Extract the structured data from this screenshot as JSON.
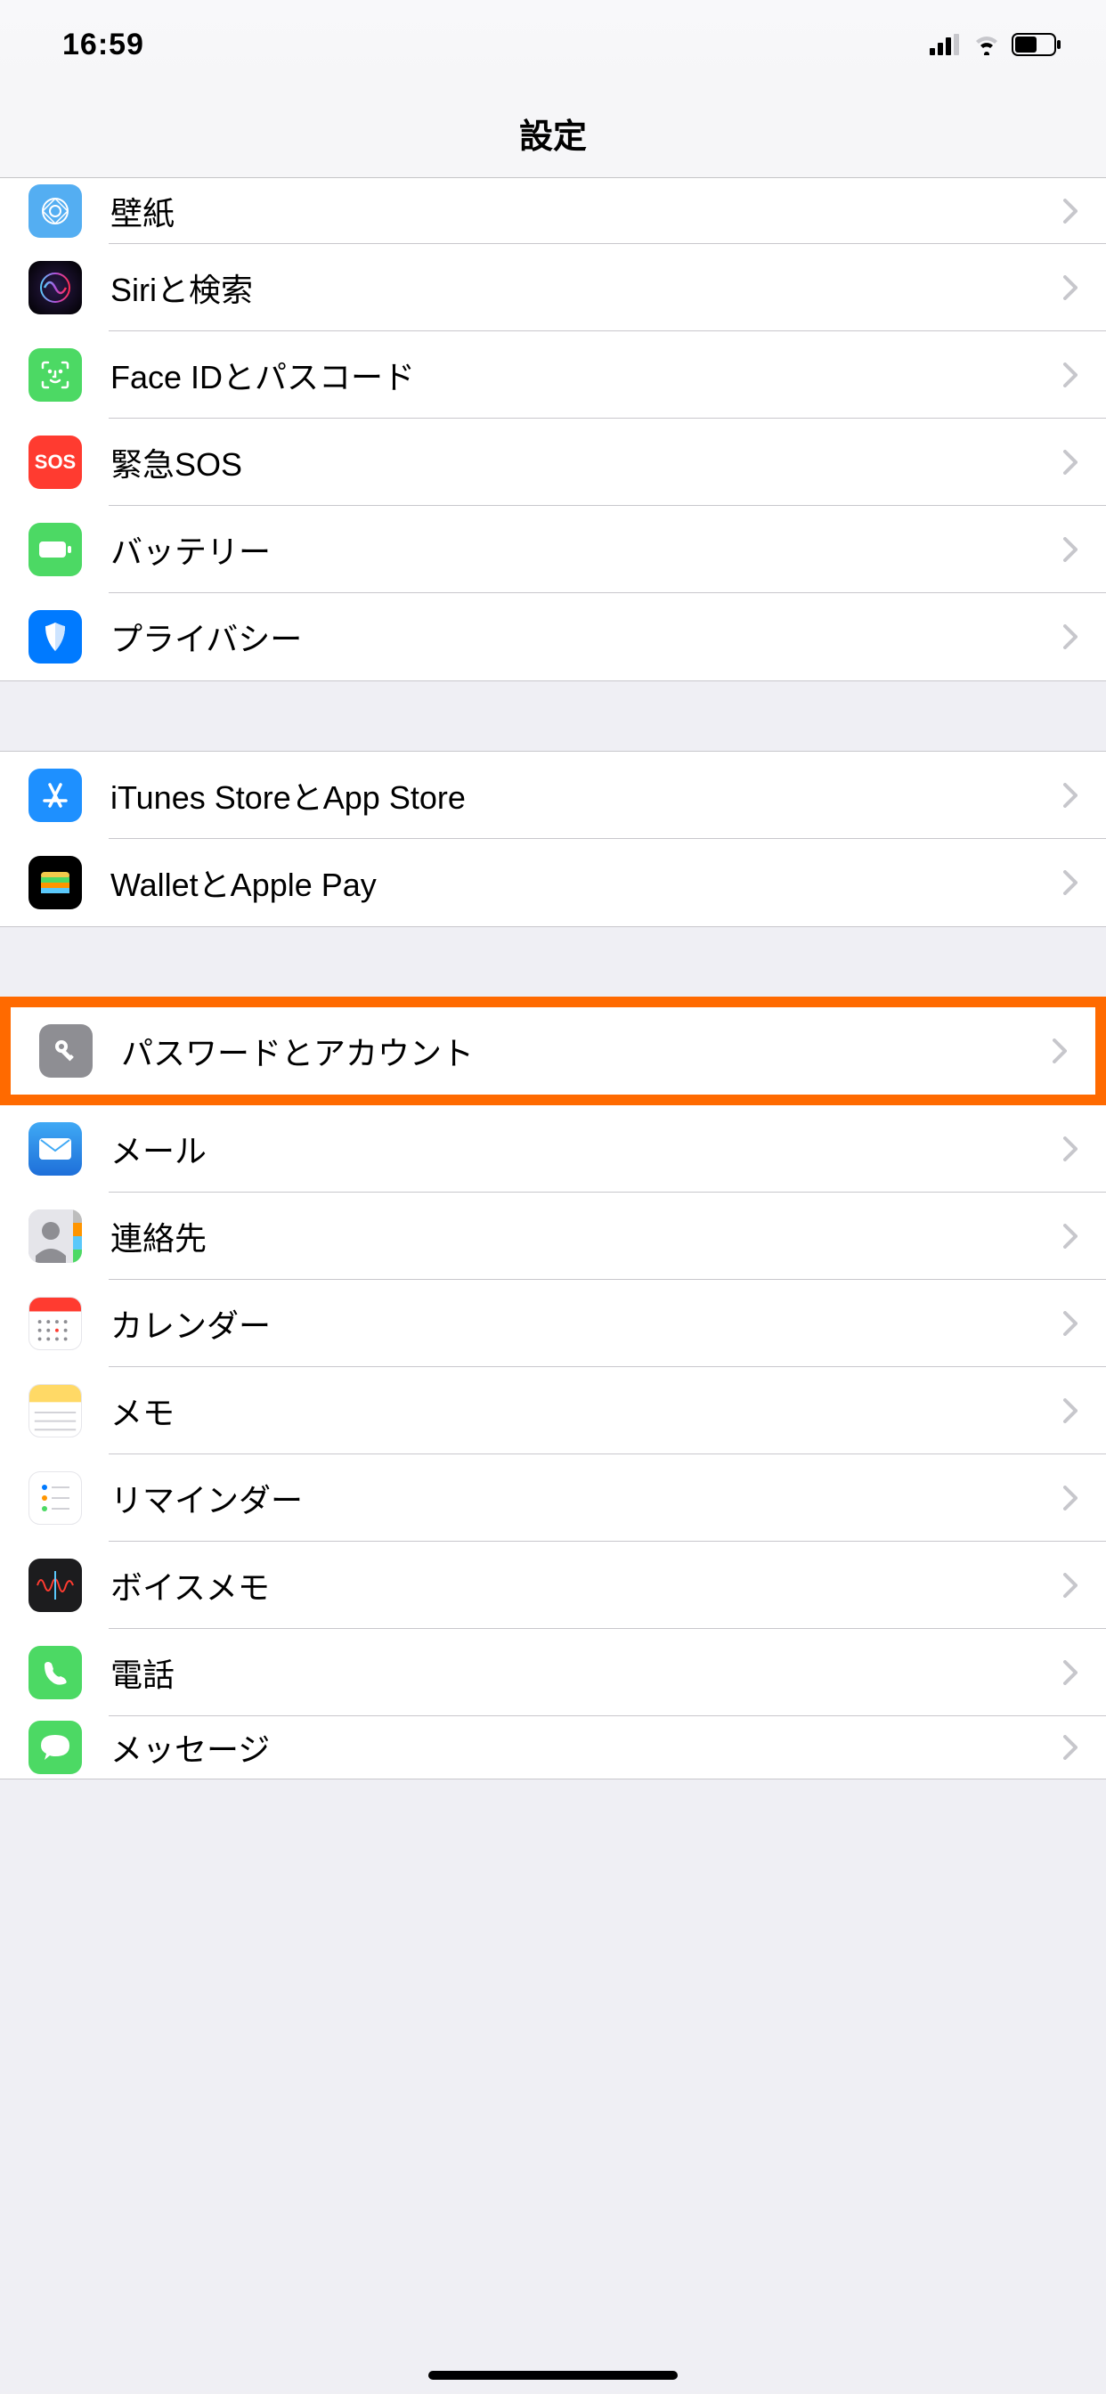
{
  "status": {
    "time": "16:59"
  },
  "header": {
    "title": "設定"
  },
  "groups": [
    {
      "rows": [
        {
          "id": "wallpaper",
          "label": "壁紙",
          "icon": "wallpaper-icon"
        },
        {
          "id": "siri",
          "label": "Siriと検索",
          "icon": "siri-icon"
        },
        {
          "id": "faceid",
          "label": "Face IDとパスコード",
          "icon": "faceid-icon"
        },
        {
          "id": "sos",
          "label": "緊急SOS",
          "icon": "sos-icon"
        },
        {
          "id": "battery",
          "label": "バッテリー",
          "icon": "battery-icon"
        },
        {
          "id": "privacy",
          "label": "プライバシー",
          "icon": "privacy-icon"
        }
      ]
    },
    {
      "rows": [
        {
          "id": "itunes",
          "label": "iTunes StoreとApp Store",
          "icon": "appstore-icon"
        },
        {
          "id": "wallet",
          "label": "WalletとApple Pay",
          "icon": "wallet-icon"
        }
      ]
    },
    {
      "rows": [
        {
          "id": "passwords",
          "label": "パスワードとアカウント",
          "icon": "key-icon",
          "highlighted": true
        },
        {
          "id": "mail",
          "label": "メール",
          "icon": "mail-icon"
        },
        {
          "id": "contacts",
          "label": "連絡先",
          "icon": "contacts-icon"
        },
        {
          "id": "calendar",
          "label": "カレンダー",
          "icon": "calendar-icon"
        },
        {
          "id": "notes",
          "label": "メモ",
          "icon": "notes-icon"
        },
        {
          "id": "reminders",
          "label": "リマインダー",
          "icon": "reminders-icon"
        },
        {
          "id": "voicememos",
          "label": "ボイスメモ",
          "icon": "voicememo-icon"
        },
        {
          "id": "phone",
          "label": "電話",
          "icon": "phone-icon"
        },
        {
          "id": "messages",
          "label": "メッセージ",
          "icon": "messages-icon"
        }
      ]
    }
  ]
}
